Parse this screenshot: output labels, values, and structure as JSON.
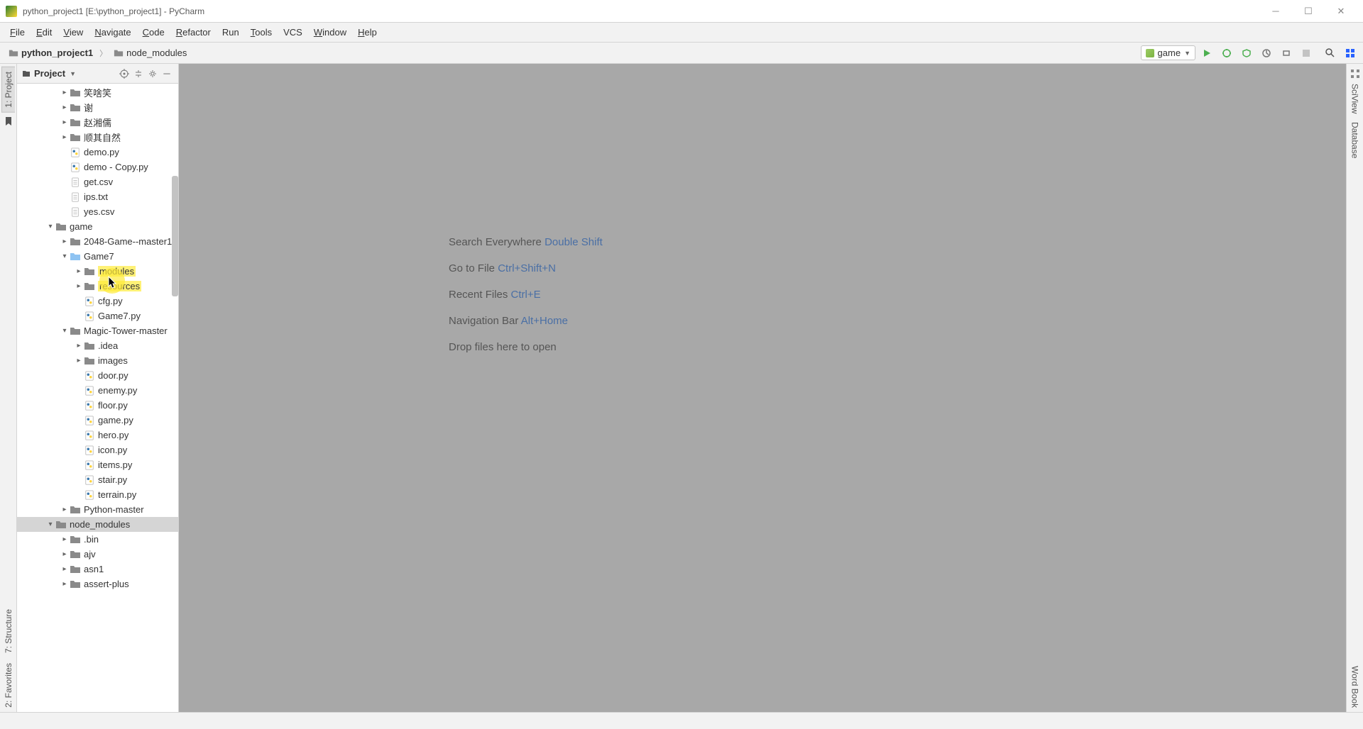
{
  "window": {
    "title": "python_project1 [E:\\python_project1] - PyCharm"
  },
  "menu": {
    "file": "File",
    "edit": "Edit",
    "view": "View",
    "navigate": "Navigate",
    "code": "Code",
    "refactor": "Refactor",
    "run": "Run",
    "tools": "Tools",
    "vcs": "VCS",
    "window": "Window",
    "help": "Help"
  },
  "breadcrumbs": {
    "root": "python_project1",
    "current": "node_modules"
  },
  "runconfig": {
    "name": "game"
  },
  "project_panel": {
    "title": "Project"
  },
  "left_tabs": {
    "project": "1: Project",
    "structure": "7: Structure",
    "favorites": "2: Favorites"
  },
  "right_tabs": {
    "sciview": "SciView",
    "database": "Database",
    "wordbook": "Word Book"
  },
  "tree": [
    {
      "indent": 3,
      "arrow": "closed",
      "type": "folder",
      "label": "笑啥笑"
    },
    {
      "indent": 3,
      "arrow": "closed",
      "type": "folder",
      "label": "谢"
    },
    {
      "indent": 3,
      "arrow": "closed",
      "type": "folder",
      "label": "赵湘儒"
    },
    {
      "indent": 3,
      "arrow": "closed",
      "type": "folder",
      "label": "顺其自然"
    },
    {
      "indent": 3,
      "arrow": "none",
      "type": "py",
      "label": "demo.py"
    },
    {
      "indent": 3,
      "arrow": "none",
      "type": "py",
      "label": "demo - Copy.py"
    },
    {
      "indent": 3,
      "arrow": "none",
      "type": "file",
      "label": "get.csv"
    },
    {
      "indent": 3,
      "arrow": "none",
      "type": "file",
      "label": "ips.txt"
    },
    {
      "indent": 3,
      "arrow": "none",
      "type": "file",
      "label": "yes.csv"
    },
    {
      "indent": 2,
      "arrow": "open",
      "type": "folder",
      "label": "game"
    },
    {
      "indent": 3,
      "arrow": "closed",
      "type": "folder",
      "label": "2048-Game--master1"
    },
    {
      "indent": 3,
      "arrow": "open",
      "type": "folder-blue",
      "label": "Game7"
    },
    {
      "indent": 4,
      "arrow": "closed",
      "type": "folder",
      "label": "modules",
      "highlight": true
    },
    {
      "indent": 4,
      "arrow": "closed",
      "type": "folder",
      "label": "resources",
      "highlight": true
    },
    {
      "indent": 4,
      "arrow": "none",
      "type": "py",
      "label": "cfg.py"
    },
    {
      "indent": 4,
      "arrow": "none",
      "type": "py",
      "label": "Game7.py"
    },
    {
      "indent": 3,
      "arrow": "open",
      "type": "folder",
      "label": "Magic-Tower-master"
    },
    {
      "indent": 4,
      "arrow": "closed",
      "type": "folder",
      "label": ".idea"
    },
    {
      "indent": 4,
      "arrow": "closed",
      "type": "folder",
      "label": "images"
    },
    {
      "indent": 4,
      "arrow": "none",
      "type": "py",
      "label": "door.py"
    },
    {
      "indent": 4,
      "arrow": "none",
      "type": "py",
      "label": "enemy.py"
    },
    {
      "indent": 4,
      "arrow": "none",
      "type": "py",
      "label": "floor.py"
    },
    {
      "indent": 4,
      "arrow": "none",
      "type": "py",
      "label": "game.py"
    },
    {
      "indent": 4,
      "arrow": "none",
      "type": "py",
      "label": "hero.py"
    },
    {
      "indent": 4,
      "arrow": "none",
      "type": "py",
      "label": "icon.py"
    },
    {
      "indent": 4,
      "arrow": "none",
      "type": "py",
      "label": "items.py"
    },
    {
      "indent": 4,
      "arrow": "none",
      "type": "py",
      "label": "stair.py"
    },
    {
      "indent": 4,
      "arrow": "none",
      "type": "py",
      "label": "terrain.py"
    },
    {
      "indent": 3,
      "arrow": "closed",
      "type": "folder",
      "label": "Python-master"
    },
    {
      "indent": 2,
      "arrow": "open",
      "type": "folder",
      "label": "node_modules",
      "selected": true
    },
    {
      "indent": 3,
      "arrow": "closed",
      "type": "folder",
      "label": ".bin"
    },
    {
      "indent": 3,
      "arrow": "closed",
      "type": "folder",
      "label": "ajv"
    },
    {
      "indent": 3,
      "arrow": "closed",
      "type": "folder",
      "label": "asn1"
    },
    {
      "indent": 3,
      "arrow": "closed",
      "type": "folder",
      "label": "assert-plus"
    }
  ],
  "hints": {
    "l1a": "Search Everywhere ",
    "l1b": "Double Shift",
    "l2a": "Go to File ",
    "l2b": "Ctrl+Shift+N",
    "l3a": "Recent Files ",
    "l3b": "Ctrl+E",
    "l4a": "Navigation Bar ",
    "l4b": "Alt+Home",
    "l5": "Drop files here to open"
  }
}
